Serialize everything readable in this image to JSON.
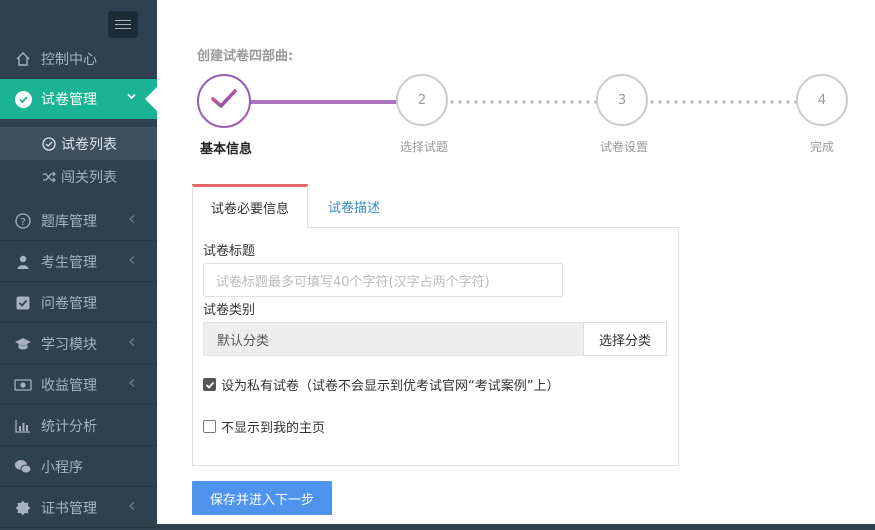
{
  "sidebar": {
    "items": [
      {
        "label": "控制中心",
        "icon": "home-icon"
      },
      {
        "label": "试卷管理",
        "icon": "check-circle-icon",
        "active": true
      },
      {
        "label": "题库管理",
        "icon": "question-circle-icon"
      },
      {
        "label": "考生管理",
        "icon": "user-icon"
      },
      {
        "label": "问卷管理",
        "icon": "check-square-icon"
      },
      {
        "label": "学习模块",
        "icon": "graduation-cap-icon"
      },
      {
        "label": "收益管理",
        "icon": "money-icon"
      },
      {
        "label": "统计分析",
        "icon": "bar-chart-icon"
      },
      {
        "label": "小程序",
        "icon": "wechat-icon"
      },
      {
        "label": "证书管理",
        "icon": "certificate-icon"
      }
    ],
    "subitems": [
      {
        "label": "试卷列表",
        "icon": "check-circle-icon",
        "active": true
      },
      {
        "label": "闯关列表",
        "icon": "shuffle-icon"
      }
    ]
  },
  "main": {
    "heading": "创建试卷四部曲:",
    "steps": [
      {
        "number": "",
        "label": "基本信息"
      },
      {
        "number": "2",
        "label": "选择试题"
      },
      {
        "number": "3",
        "label": "试卷设置"
      },
      {
        "number": "4",
        "label": "完成"
      }
    ],
    "tabs": [
      {
        "label": "试卷必要信息"
      },
      {
        "label": "试卷描述"
      }
    ],
    "form": {
      "title_label": "试卷标题",
      "title_placeholder": "试卷标题最多可填写40个字符(汉字占两个字符)",
      "category_label": "试卷类别",
      "category_value": "默认分类",
      "category_button": "选择分类",
      "private_label": "设为私有试卷（试卷不会显示到优考试官网“考试案例”上）",
      "private_checked": true,
      "hide_label": "不显示到我的主页",
      "hide_checked": false
    },
    "submit_label": "保存并进入下一步"
  },
  "colors": {
    "sidebar_bg": "#2f4050",
    "active_green": "#1ab394",
    "step_purple": "#9b59b6",
    "tab_red": "#e46666",
    "primary_blue": "#4e94ee"
  }
}
